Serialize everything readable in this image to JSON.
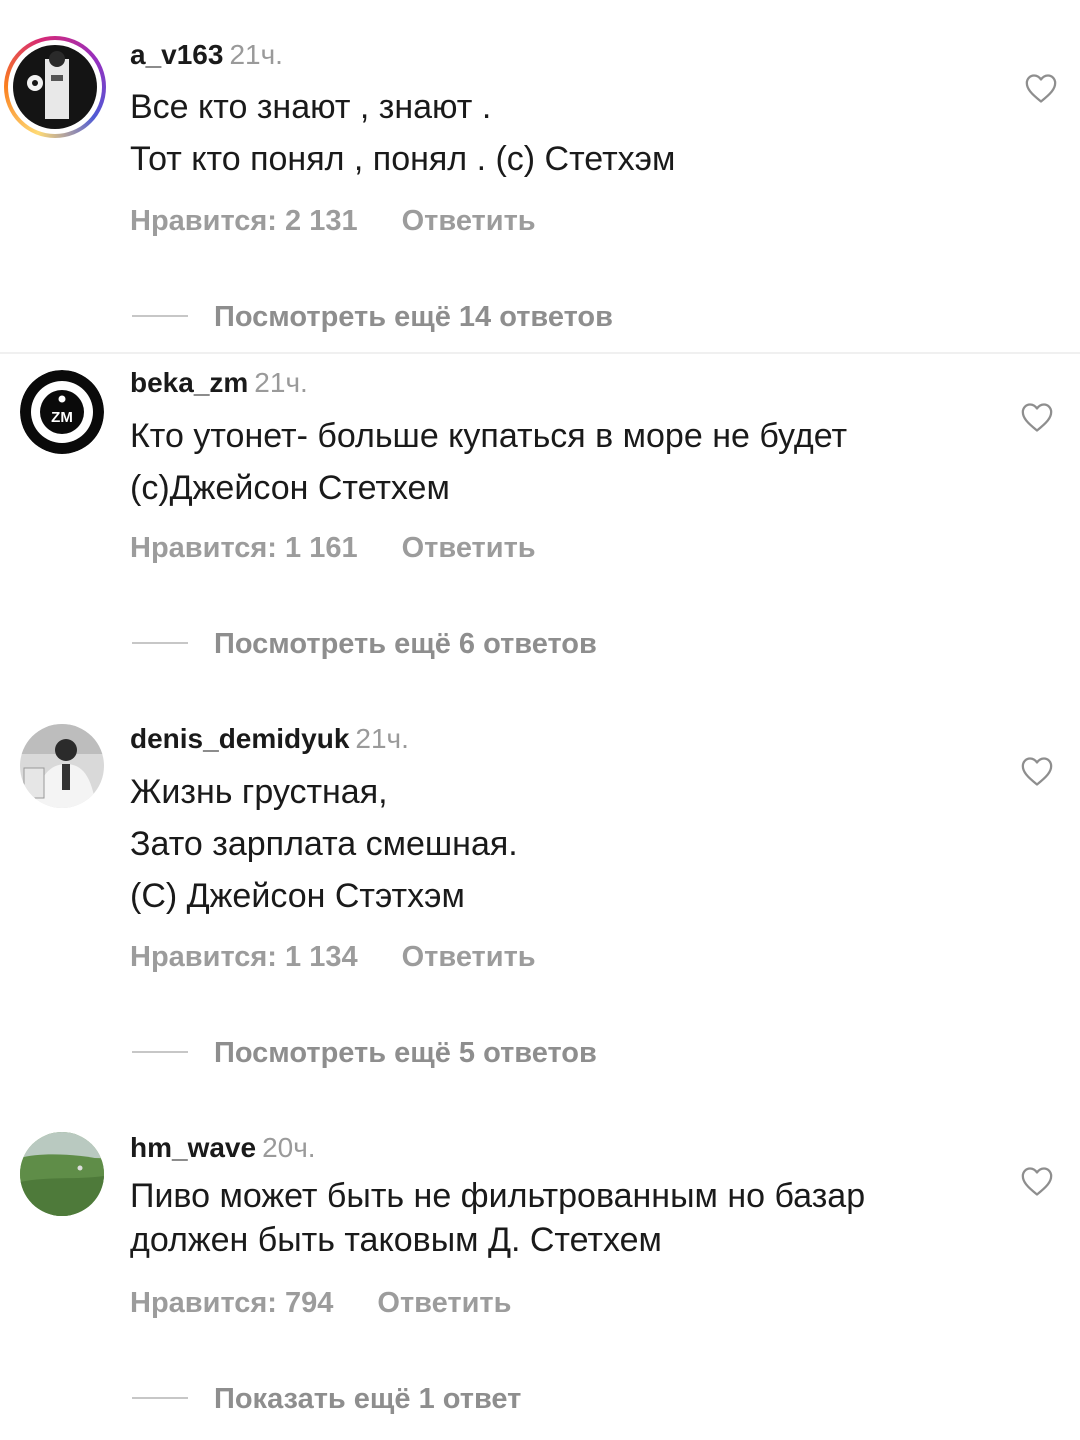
{
  "comments": [
    {
      "username": "a_v163",
      "time": "21ч.",
      "lines": [
        "Все кто знают , знают .",
        "Тот кто понял , понял . (с) Стетхэм"
      ],
      "likes": "Нравится: 2 131",
      "reply": "Ответить",
      "view_replies": "Посмотреть ещё 14 ответов"
    },
    {
      "username": "beka_zm",
      "time": "21ч.",
      "lines": [
        "Кто утонет- больше купаться в море не будет",
        "(с)Джейсон Стетхем"
      ],
      "likes": "Нравится: 1 161",
      "reply": "Ответить",
      "view_replies": "Посмотреть ещё 6 ответов",
      "avatar_text": "ZM"
    },
    {
      "username": "denis_demidyuk",
      "time": "21ч.",
      "lines": [
        "Жизнь грустная,",
        "Зато зарплата смешная.",
        "(С) Джейсон Стэтхэм"
      ],
      "likes": "Нравится: 1 134",
      "reply": "Ответить",
      "view_replies": "Посмотреть ещё 5 ответов"
    },
    {
      "username": "hm_wave",
      "time": "20ч.",
      "lines": [
        "Пиво может быть не фильтрованным но базар",
        "должен быть таковым  Д. Стетхем"
      ],
      "likes": "Нравится: 794",
      "reply": "Ответить",
      "view_replies": "Показать ещё 1 ответ"
    }
  ],
  "icons": {
    "like": "heart-outline-icon",
    "avatar_story_ring": "instagram-story-ring"
  },
  "colors": {
    "text": "#1a1a1a",
    "secondary": "#9c9c9c",
    "divider": "#f0f0f0"
  }
}
